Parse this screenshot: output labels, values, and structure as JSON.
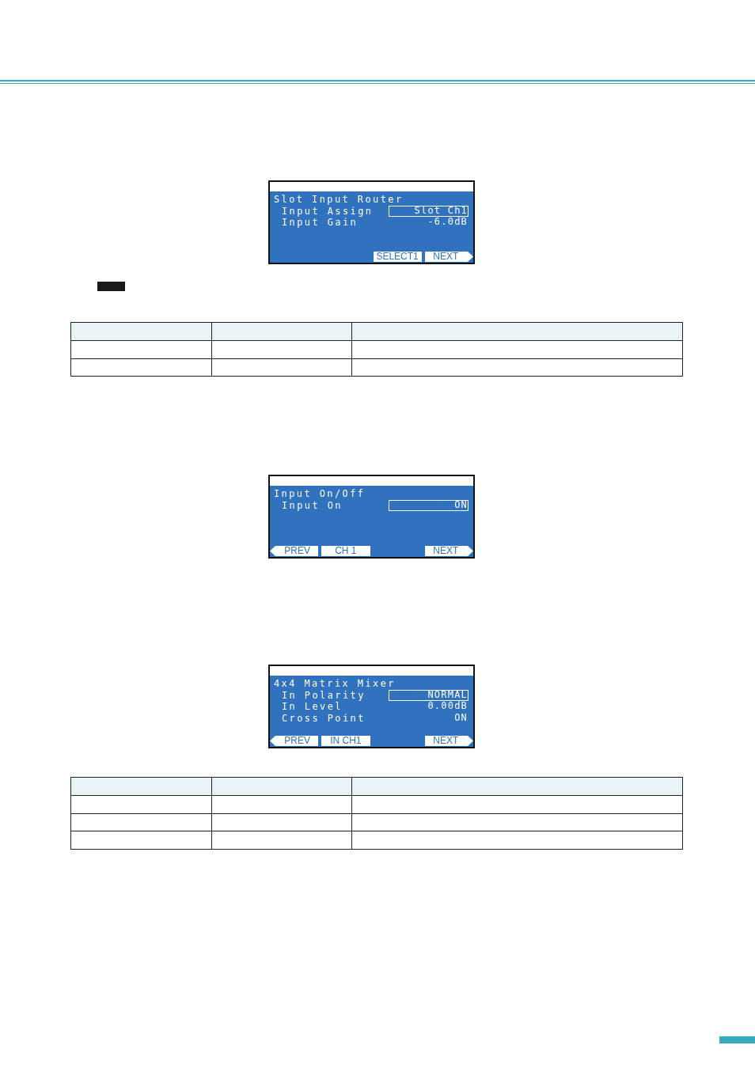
{
  "blocks": [
    {
      "kind": "lcd",
      "title": "Slot Input Router",
      "params": [
        {
          "label": "Input Assign",
          "value": "Slot Ch1",
          "selected": true
        },
        {
          "label": "Input Gain",
          "value": "-6.0dB",
          "selected": false
        }
      ],
      "softkeys": [
        {
          "kind": "blank"
        },
        {
          "kind": "blank"
        },
        {
          "kind": "plain",
          "label": "SELECT1"
        },
        {
          "kind": "next",
          "label": "NEXT"
        }
      ]
    },
    {
      "kind": "tag"
    },
    {
      "kind": "table",
      "rows": [
        {
          "kind": "header"
        },
        {
          "kind": "body"
        },
        {
          "kind": "body"
        }
      ]
    },
    {
      "kind": "lcd",
      "title": "Input On/Off",
      "params": [
        {
          "label": "Input On",
          "value": "ON",
          "selected": true
        }
      ],
      "softkeys": [
        {
          "kind": "prev",
          "label": "PREV"
        },
        {
          "kind": "plain",
          "label": "CH 1"
        },
        {
          "kind": "blank"
        },
        {
          "kind": "next",
          "label": "NEXT"
        }
      ]
    },
    {
      "kind": "lcd",
      "title": "4x4 Matrix Mixer",
      "params": [
        {
          "label": "In Polarity",
          "value": "NORMAL",
          "selected": true
        },
        {
          "label": "In Level",
          "value": "0.00dB",
          "selected": false
        },
        {
          "label": "Cross Point",
          "value": "ON",
          "selected": false
        }
      ],
      "softkeys": [
        {
          "kind": "prev",
          "label": "PREV"
        },
        {
          "kind": "plain",
          "label": "IN CH1"
        },
        {
          "kind": "blank"
        },
        {
          "kind": "next",
          "label": "NEXT"
        }
      ]
    },
    {
      "kind": "table",
      "rows": [
        {
          "kind": "header"
        },
        {
          "kind": "body"
        },
        {
          "kind": "body"
        },
        {
          "kind": "body"
        }
      ]
    }
  ]
}
